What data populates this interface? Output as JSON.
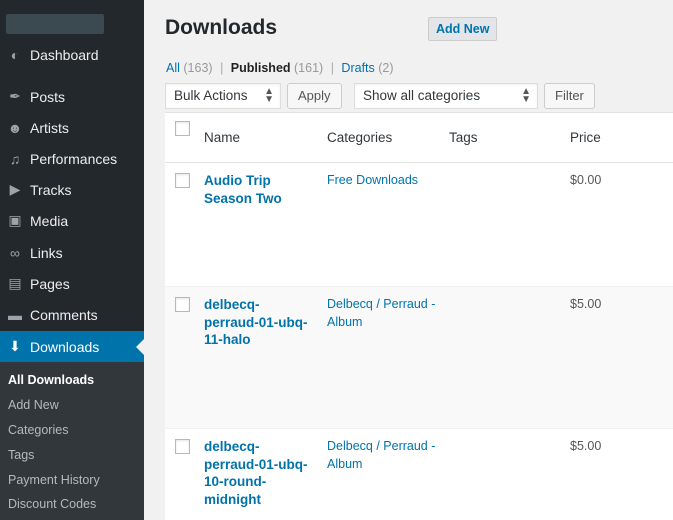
{
  "sidebar": {
    "menu": [
      {
        "label": "Dashboard",
        "icon": "dashboard-icon",
        "glyph": "◐"
      },
      {
        "label": "Posts",
        "icon": "pin-icon",
        "glyph": "✒"
      },
      {
        "label": "Artists",
        "icon": "user-icon",
        "glyph": "☻"
      },
      {
        "label": "Performances",
        "icon": "music-note-icon",
        "glyph": "♫"
      },
      {
        "label": "Tracks",
        "icon": "video-icon",
        "glyph": "▶"
      },
      {
        "label": "Media",
        "icon": "media-icon",
        "glyph": "▣"
      },
      {
        "label": "Links",
        "icon": "link-icon",
        "glyph": "∞"
      },
      {
        "label": "Pages",
        "icon": "pages-icon",
        "glyph": "▤"
      },
      {
        "label": "Comments",
        "icon": "comment-icon",
        "glyph": "▬"
      },
      {
        "label": "Downloads",
        "icon": "download-icon",
        "glyph": "⬇"
      }
    ],
    "submenu": [
      "All Downloads",
      "Add New",
      "Categories",
      "Tags",
      "Payment History",
      "Discount Codes"
    ]
  },
  "header": {
    "title": "Downloads",
    "add_new": "Add New"
  },
  "filters": {
    "all": "All",
    "all_count": "(163)",
    "published": "Published",
    "published_count": "(161)",
    "drafts": "Drafts",
    "drafts_count": "(2)",
    "sep": "|"
  },
  "toolbar": {
    "bulk_actions": "Bulk Actions",
    "apply": "Apply",
    "categories": "Show all categories",
    "filter": "Filter"
  },
  "table": {
    "columns": [
      "Name",
      "Categories",
      "Tags",
      "Price"
    ],
    "rows": [
      {
        "name": "Audio Trip Season Two",
        "category": "Free Downloads",
        "tags": "",
        "price": "$0.00"
      },
      {
        "name": "delbecq-perraud-01-ubq-11-halo",
        "category": "Delbecq / Perraud - Album",
        "tags": "",
        "price": "$5.00"
      },
      {
        "name": "delbecq-perraud-01-ubq-10-round-midnight",
        "category": "Delbecq / Perraud - Album",
        "tags": "",
        "price": "$5.00"
      }
    ]
  },
  "colors": {
    "accent": "#0073aa",
    "sidebar": "#23282d",
    "submenu": "#32373c"
  }
}
